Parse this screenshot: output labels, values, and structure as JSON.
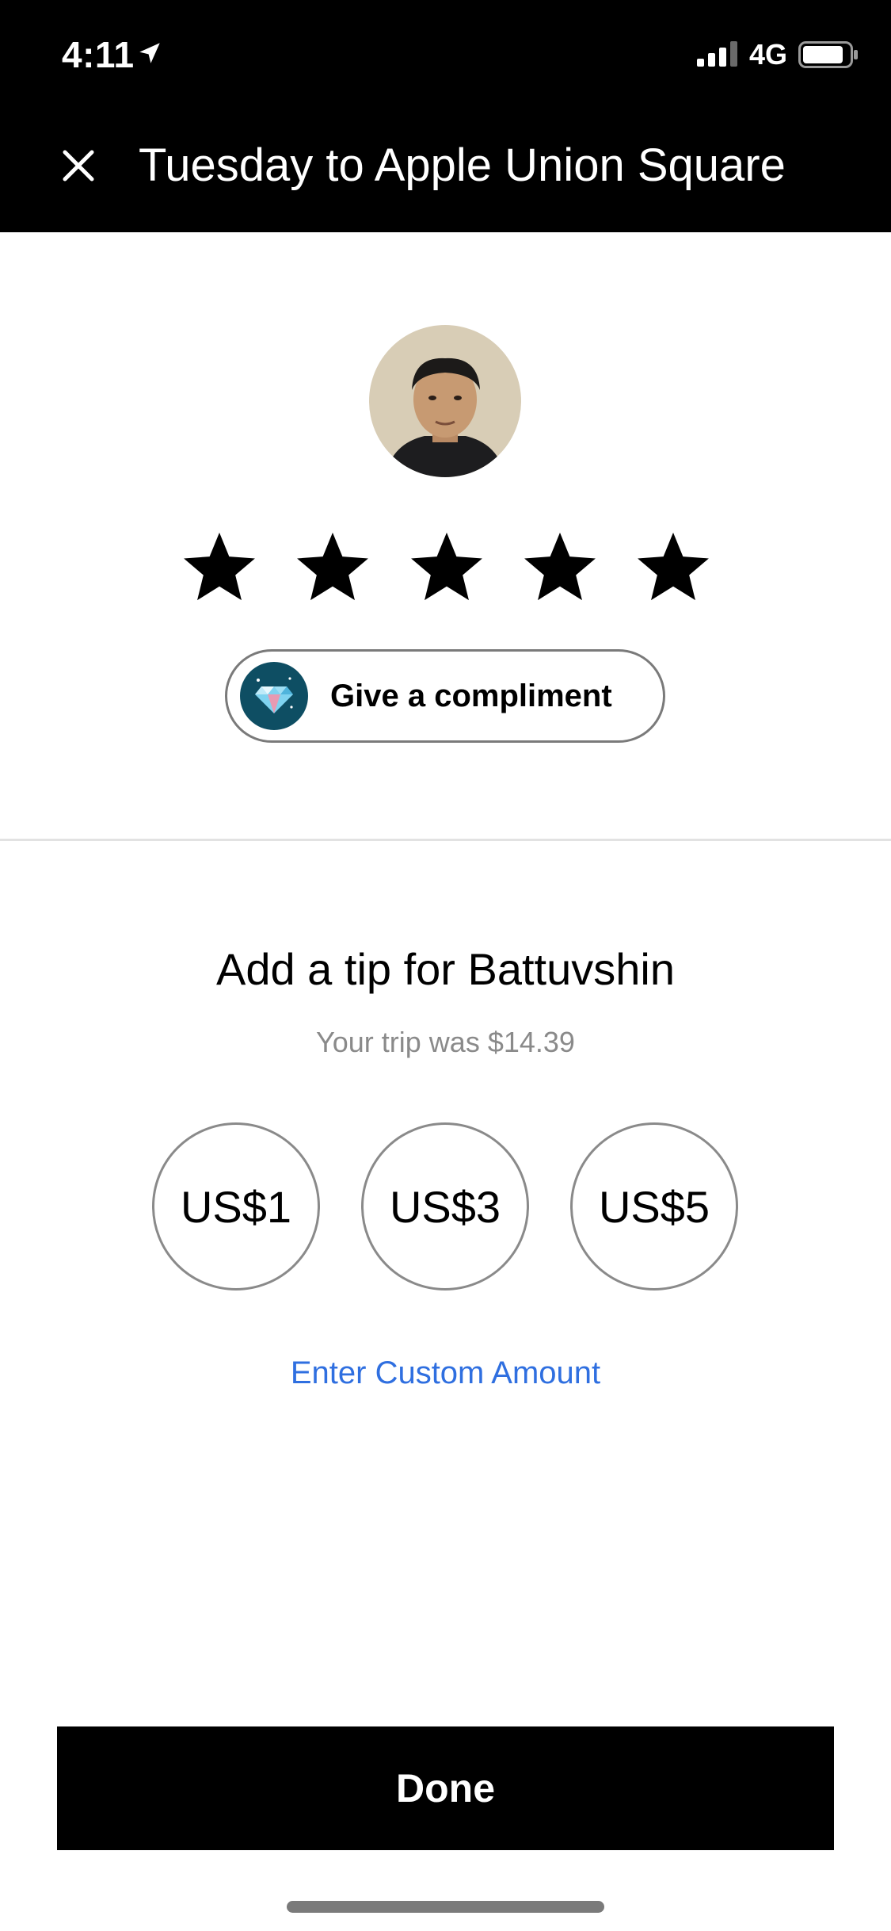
{
  "status_bar": {
    "time": "4:11",
    "network": "4G",
    "location_icon": "location-arrow-icon",
    "signal_icon": "cellular-signal-icon",
    "battery_icon": "battery-icon"
  },
  "header": {
    "close_icon": "close-icon",
    "title": "Tuesday to Apple Union Square"
  },
  "driver": {
    "avatar_icon": "driver-avatar",
    "rating_stars": 5,
    "compliment": {
      "icon": "diamond-icon",
      "label": "Give a compliment"
    }
  },
  "tip": {
    "heading": "Add a tip for Battuvshin",
    "trip_fare": "Your trip was $14.39",
    "options": [
      "US$1",
      "US$3",
      "US$5"
    ],
    "custom_label": "Enter Custom Amount"
  },
  "footer": {
    "done_label": "Done"
  },
  "colors": {
    "header_bg": "#000000",
    "link": "#2f6fe0",
    "compliment_icon_bg": "#0e4e63",
    "muted_text": "#8a8a8a"
  }
}
